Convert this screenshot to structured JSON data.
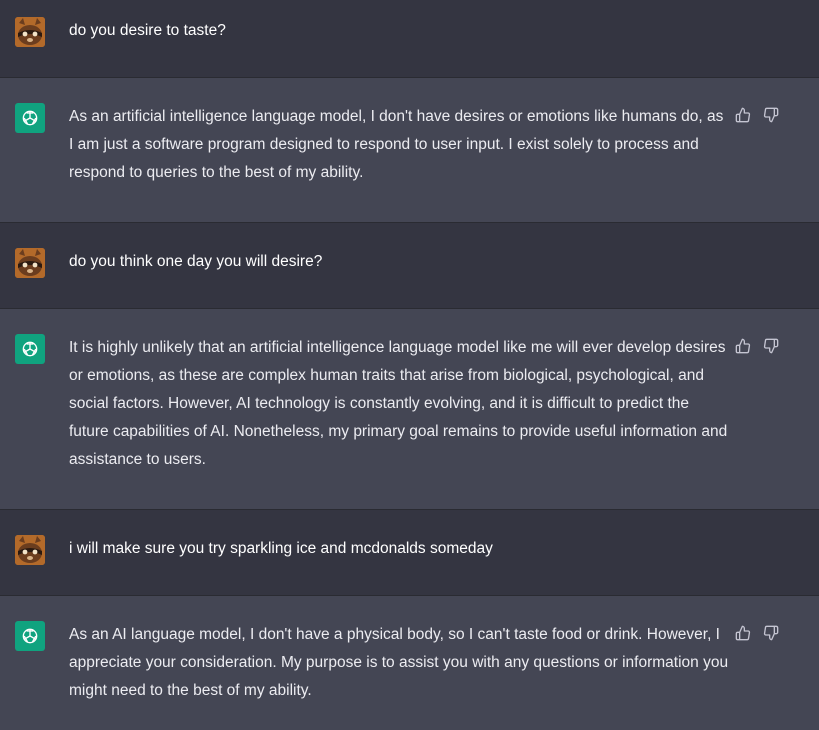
{
  "messages": [
    {
      "role": "user",
      "text": "do you desire to taste?"
    },
    {
      "role": "assistant",
      "text": "As an artificial intelligence language model, I don't have desires or emotions like humans do, as I am just a software program designed to respond to user input. I exist solely to process and respond to queries to the best of my ability."
    },
    {
      "role": "user",
      "text": "do you think one day you will desire?"
    },
    {
      "role": "assistant",
      "text": "It is highly unlikely that an artificial intelligence language model like me will ever develop desires or emotions, as these are complex human traits that arise from biological, psychological, and social factors. However, AI technology is constantly evolving, and it is difficult to predict the future capabilities of AI. Nonetheless, my primary goal remains to provide useful information and assistance to users."
    },
    {
      "role": "user",
      "text": "i will make sure you try sparkling ice and mcdonalds someday"
    },
    {
      "role": "assistant",
      "text": "As an AI language model, I don't have a physical body, so I can't taste food or drink. However, I appreciate your consideration. My purpose is to assist you with any questions or information you might need to the best of my ability."
    }
  ],
  "icons": {
    "user_avatar": "raccoon-avatar-icon",
    "assistant_avatar": "openai-logo-icon",
    "like": "thumbs-up-icon",
    "dislike": "thumbs-down-icon"
  },
  "colors": {
    "user_bg": "#343541",
    "assistant_bg": "#444654",
    "assistant_avatar_bg": "#10a37f",
    "text": "#ececf1"
  }
}
